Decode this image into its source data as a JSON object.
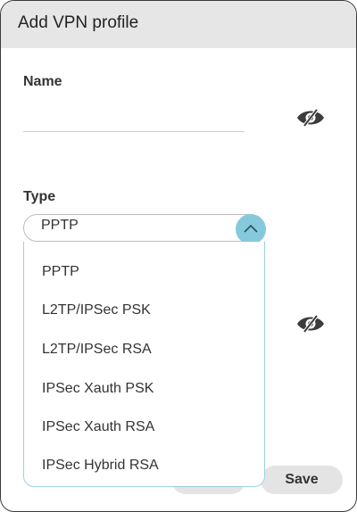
{
  "dialog": {
    "title": "Add VPN profile"
  },
  "name_field": {
    "label": "Name",
    "value": "",
    "placeholder": ""
  },
  "type_field": {
    "label": "Type",
    "selected": "PPTP",
    "options": [
      "PPTP",
      "L2TP/IPSec PSK",
      "L2TP/IPSec RSA",
      "IPSec Xauth PSK",
      "IPSec Xauth RSA",
      "IPSec Hybrid RSA"
    ]
  },
  "buttons": {
    "save_label": "Save"
  },
  "icons": {
    "visibility": "eye-slash-icon",
    "dropdown": "chevron-up-icon"
  },
  "colors": {
    "header_bg": "#e6e6e6",
    "accent": "#86c9dc",
    "dropdown_border": "#9fd0de",
    "button_bg": "#e4e4e4",
    "text": "#333333"
  }
}
